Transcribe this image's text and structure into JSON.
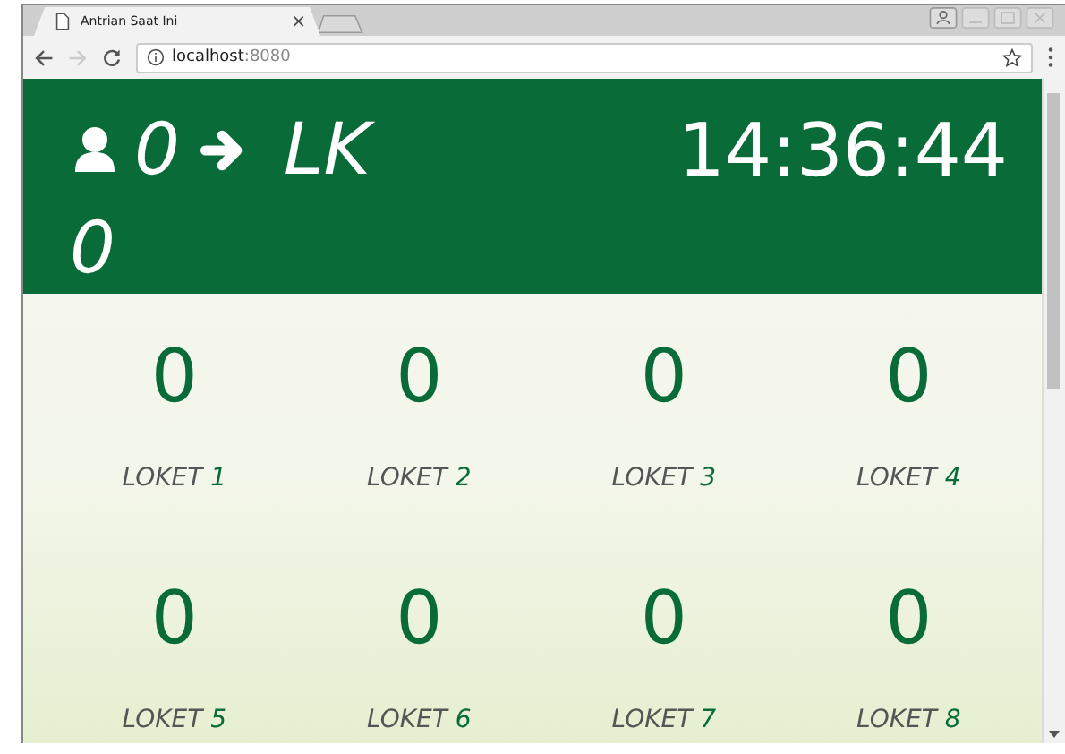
{
  "tab": {
    "title": "Antrian Saat Ini",
    "close": "×"
  },
  "address": {
    "host": "localhost",
    "port": ":8080"
  },
  "header": {
    "count": "0",
    "target": "LK",
    "target_wrap": "0",
    "clock": "14:36:44"
  },
  "counters": [
    {
      "value": "0",
      "word": "LOKET",
      "number": "1"
    },
    {
      "value": "0",
      "word": "LOKET",
      "number": "2"
    },
    {
      "value": "0",
      "word": "LOKET",
      "number": "3"
    },
    {
      "value": "0",
      "word": "LOKET",
      "number": "4"
    },
    {
      "value": "0",
      "word": "LOKET",
      "number": "5"
    },
    {
      "value": "0",
      "word": "LOKET",
      "number": "6"
    },
    {
      "value": "0",
      "word": "LOKET",
      "number": "7"
    },
    {
      "value": "0",
      "word": "LOKET",
      "number": "8"
    }
  ]
}
